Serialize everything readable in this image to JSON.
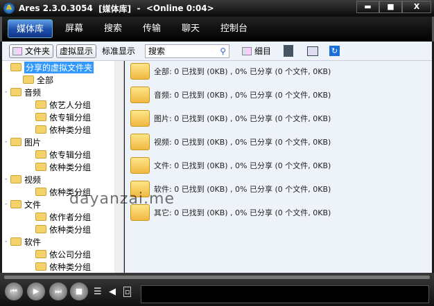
{
  "title": {
    "app": "Ares 2.3.0.3054",
    "section": "[媒体库]",
    "sep": "-",
    "status": "<Online 0:04>"
  },
  "window": {
    "minimize": "▬",
    "maximize": "■",
    "close": "X"
  },
  "tabs": [
    "媒体库",
    "屏幕",
    "搜索",
    "传输",
    "聊天",
    "控制台"
  ],
  "toolbar": {
    "folder": "文件夹",
    "virtual": "虚拟显示",
    "standard": "标准显示",
    "search_value": "搜索",
    "details": "细目"
  },
  "tree": [
    {
      "label": "分享的虚拟文件夹",
      "level": 0,
      "selected": true
    },
    {
      "label": "全部",
      "level": 1
    },
    {
      "label": "音频",
      "level": 0,
      "exp": true
    },
    {
      "label": "依艺人分组",
      "level": 2
    },
    {
      "label": "依专辑分组",
      "level": 2
    },
    {
      "label": "依种类分组",
      "level": 2
    },
    {
      "label": "图片",
      "level": 0,
      "exp": true
    },
    {
      "label": "依专辑分组",
      "level": 2
    },
    {
      "label": "依种类分组",
      "level": 2
    },
    {
      "label": "视频",
      "level": 0,
      "exp": true
    },
    {
      "label": "依种类分组",
      "level": 2
    },
    {
      "label": "文件",
      "level": 0,
      "exp": true
    },
    {
      "label": "依作者分组",
      "level": 2
    },
    {
      "label": "依种类分组",
      "level": 2
    },
    {
      "label": "软件",
      "level": 0,
      "exp": true
    },
    {
      "label": "依公司分组",
      "level": 2
    },
    {
      "label": "依种类分组",
      "level": 2
    }
  ],
  "categories": [
    "全部: 0 已找到 (0KB) , 0% 已分享 (0 个文件, 0KB)",
    "音频: 0 已找到 (0KB) , 0% 已分享 (0 个文件, 0KB)",
    "图片: 0 已找到 (0KB) , 0% 已分享 (0 个文件, 0KB)",
    "视频: 0 已找到 (0KB) , 0% 已分享 (0 个文件, 0KB)",
    "文件: 0 已找到 (0KB) , 0% 已分享 (0 个文件, 0KB)",
    "软件: 0 已找到 (0KB) , 0% 已分享 (0 个文件, 0KB)",
    "其它: 0 已找到 (0KB) , 0% 已分享 (0 个文件, 0KB)"
  ],
  "watermark": "dayanzai.me"
}
